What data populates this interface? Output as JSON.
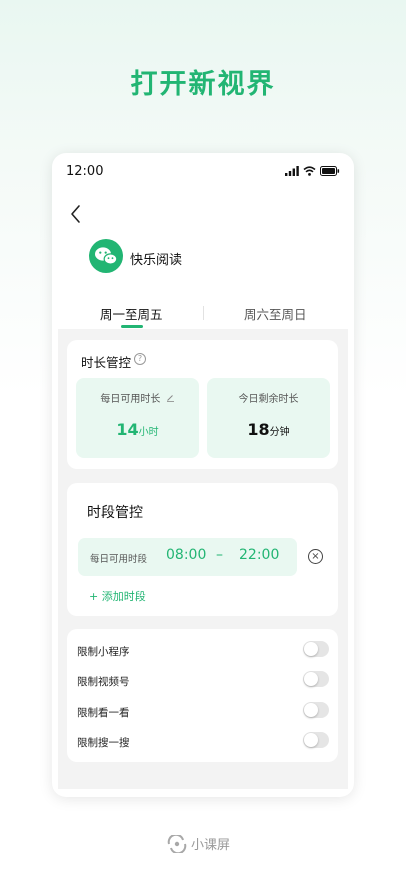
{
  "headline": "打开新视界",
  "status_bar": {
    "time": "12:00"
  },
  "app": {
    "name": "快乐阅读"
  },
  "tabs": [
    {
      "label": "周一至周五",
      "active": true
    },
    {
      "label": "周六至周日",
      "active": false
    }
  ],
  "duration_control": {
    "title": "时长管控",
    "daily_available": {
      "label": "每日可用时长",
      "value": "14",
      "unit": "小时"
    },
    "remaining_today": {
      "label": "今日剩余时长",
      "value": "18",
      "unit": "分钟"
    }
  },
  "period_control": {
    "title": "时段管控",
    "period": {
      "label": "每日可用时段",
      "start": "08:00",
      "dash": "–",
      "end": "22:00"
    },
    "add_label": "+ 添加时段"
  },
  "restrictions": [
    {
      "label": "限制小程序",
      "enabled": false
    },
    {
      "label": "限制视频号",
      "enabled": false
    },
    {
      "label": "限制看一看",
      "enabled": false
    },
    {
      "label": "限制搜一搜",
      "enabled": false
    }
  ],
  "brand": {
    "name": "小课屏"
  },
  "colors": {
    "accent": "#22b573",
    "accent_light": "#e9f8f1",
    "panel_bg": "#f3f3f3"
  },
  "icons": {
    "back": "chevron-left-icon",
    "help": "question-circle-icon",
    "edit": "pencil-icon",
    "remove": "close-circle-icon",
    "app": "wechat-icon",
    "brand": "brand-logo-icon"
  }
}
